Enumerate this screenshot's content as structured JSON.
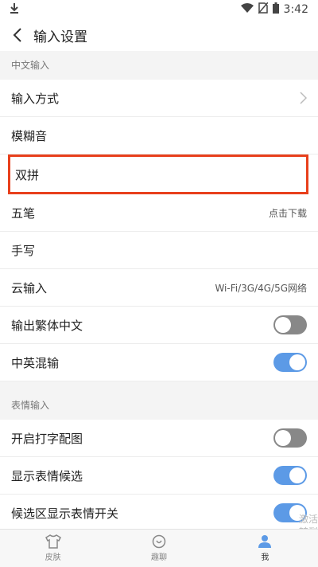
{
  "status": {
    "time": "3:42"
  },
  "header": {
    "title": "输入设置"
  },
  "sections": [
    {
      "title": "中文输入"
    },
    {
      "title": "表情输入"
    }
  ],
  "rows": {
    "input_method": {
      "label": "输入方式"
    },
    "fuzzy": {
      "label": "模糊音"
    },
    "shuangpin": {
      "label": "双拼"
    },
    "wubi": {
      "label": "五笔",
      "value": "点击下载"
    },
    "handwrite": {
      "label": "手写"
    },
    "cloud": {
      "label": "云输入",
      "value": "Wi-Fi/3G/4G/5G网络"
    },
    "traditional": {
      "label": "输出繁体中文",
      "toggle": false
    },
    "mixed": {
      "label": "中英混输",
      "toggle": true
    },
    "emoji_pic": {
      "label": "开启打字配图",
      "toggle": false
    },
    "emoji_candidate": {
      "label": "显示表情候选",
      "toggle": true
    },
    "emoji_switch": {
      "label": "候选区显示表情开关",
      "toggle": true
    }
  },
  "nav": [
    {
      "label": "皮肤",
      "icon": "shirt-icon"
    },
    {
      "label": "趣聊",
      "icon": "chat-icon"
    },
    {
      "label": "我",
      "icon": "person-icon"
    }
  ],
  "watermark": {
    "line1": "激活",
    "line2": "转到"
  },
  "colors": {
    "accent": "#5c9ae6",
    "highlight": "#e8401c"
  }
}
